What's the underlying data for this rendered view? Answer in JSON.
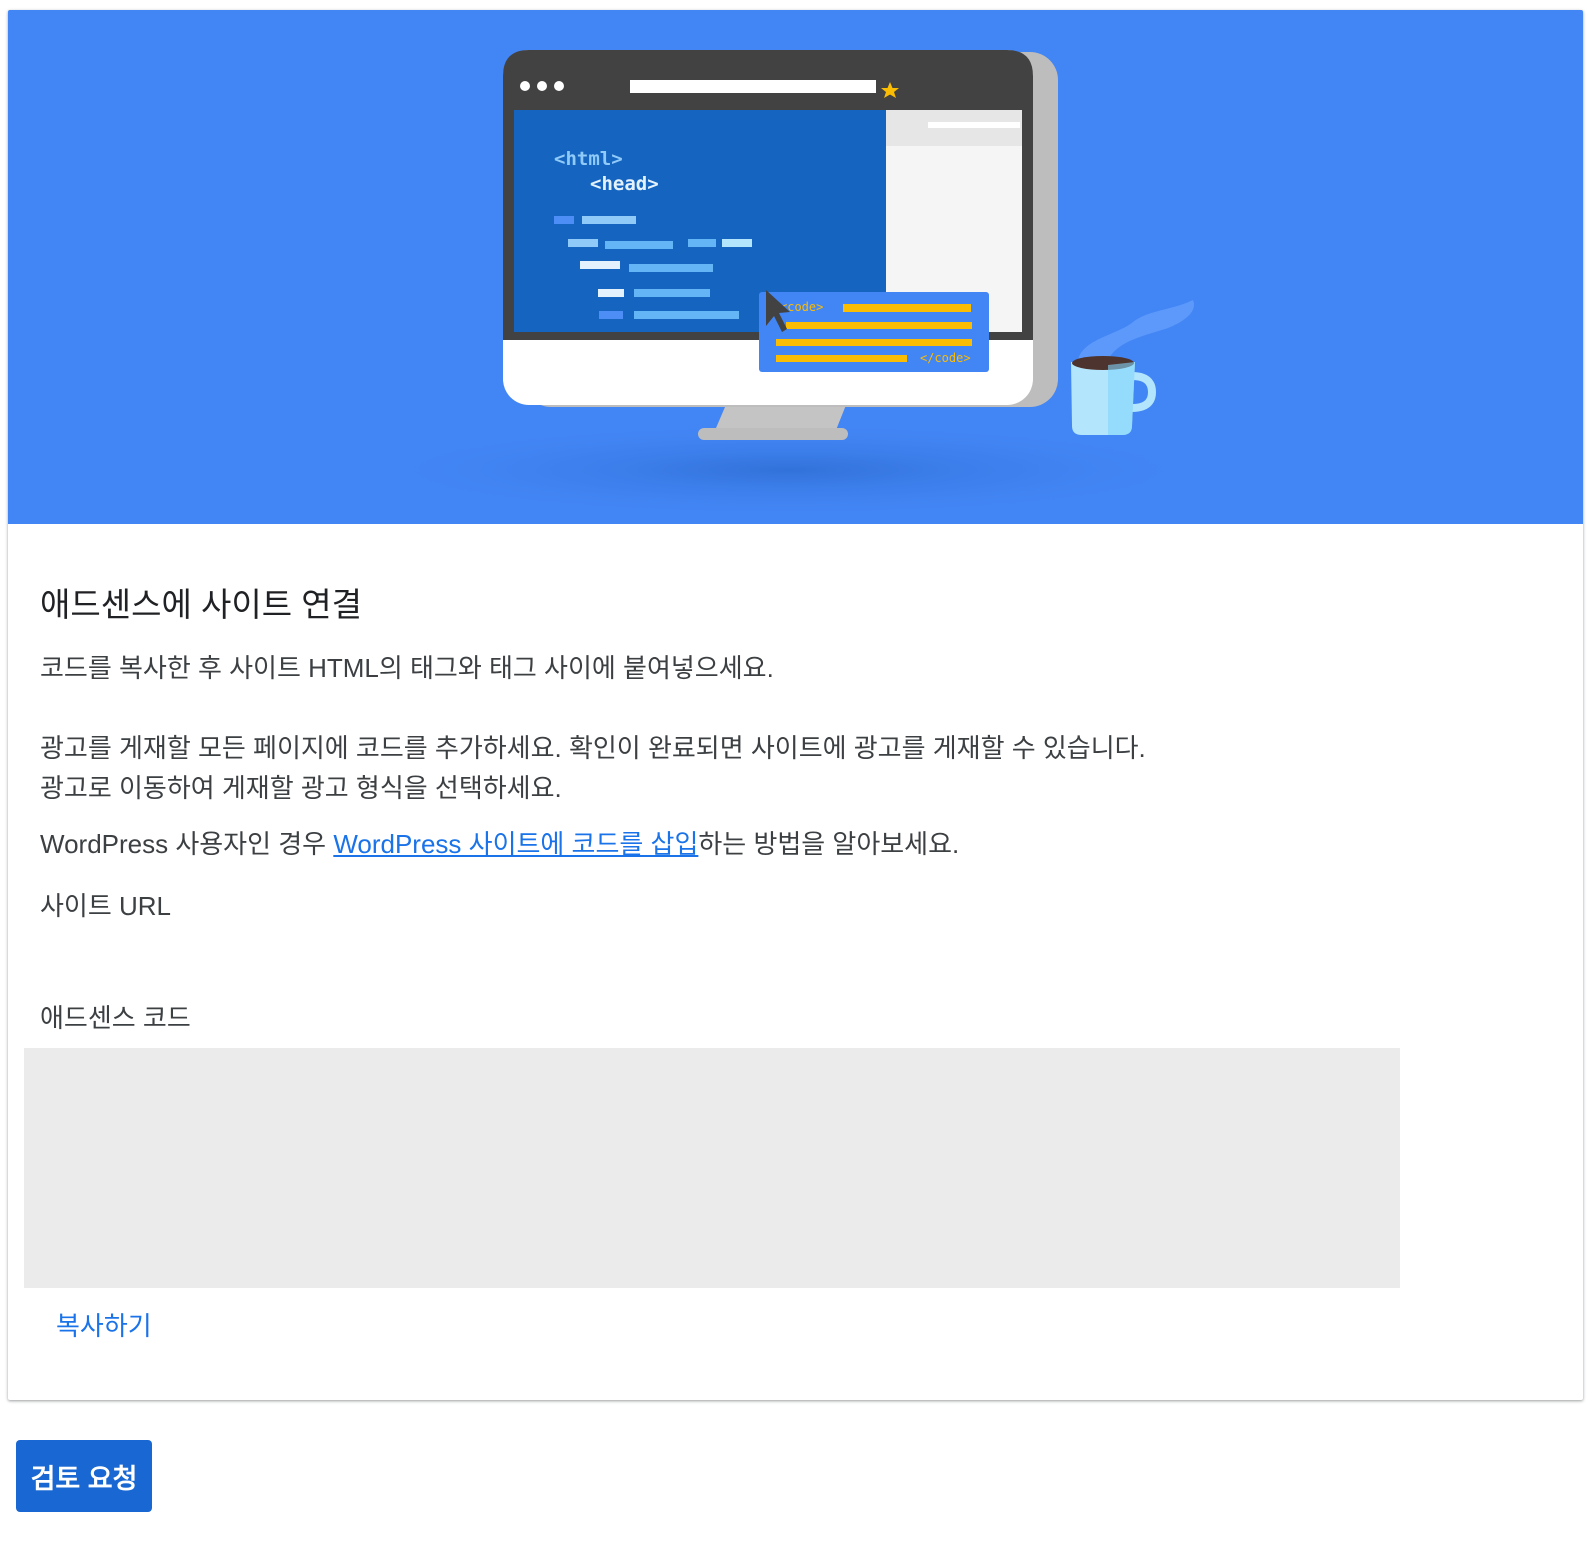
{
  "hero": {
    "code_open_html": "<html>",
    "code_open_head": "<head>",
    "code_tag_open": "<code>",
    "code_tag_close": "</code>",
    "colors": {
      "background": "#4285f4",
      "monitor_frame": "#424242",
      "editor": "#1565c0",
      "accent": "#fbbc04"
    }
  },
  "title": "애드센스에 사이트 연결",
  "instructions": {
    "line1": "코드를 복사한 후 사이트 HTML의 태그와 태그 사이에 붙여넣으세요.",
    "line2a": "광고를 게재할 모든 페이지에 코드를 추가하세요. 확인이 완료되면 사이트에 광고를 게재할 수 있습니다.",
    "line2b": "광고로 이동하여 게재할 광고 형식을 선택하세요.",
    "wp_prefix": "WordPress 사용자인 경우 ",
    "wp_link": "WordPress 사이트에 코드를 삽입",
    "wp_suffix": "하는 방법을 알아보세요."
  },
  "site_url_label": "사이트 URL",
  "adsense_code_label": "애드센스 코드",
  "copy_label": "복사하기",
  "review_button": "검토 요청"
}
